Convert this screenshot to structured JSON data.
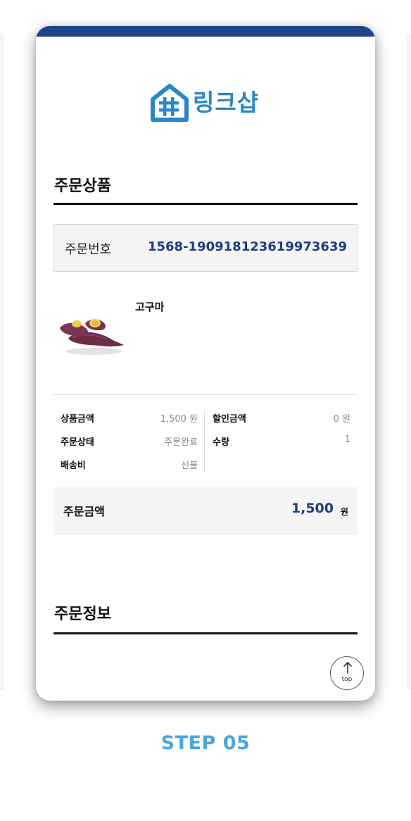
{
  "brand": {
    "name": "링크샵"
  },
  "colors": {
    "header_bar": "#1d4587",
    "accent_navy": "#1d3e80",
    "brand_blue": "#2c86c6",
    "step_blue": "#4aa4e0"
  },
  "order_section": {
    "title": "주문상품",
    "order_number_label": "주문번호",
    "order_number": "1568-190918123619973639",
    "product": {
      "name": "고구마",
      "image": "sweet-potato-image"
    },
    "details": {
      "product_amount_label": "상품금액",
      "product_amount": "1,500 원",
      "discount_label": "할인금액",
      "discount": "0 원",
      "status_label": "주문상태",
      "status": "주문완료",
      "quantity_label": "수량",
      "quantity": "1",
      "shipping_label": "배송비",
      "shipping": "선불"
    },
    "total_label": "주문금액",
    "total_amount": "1,500",
    "total_unit": "원"
  },
  "info_section": {
    "title": "주문정보"
  },
  "top_button": {
    "label": "top",
    "icon": "arrow-up-icon"
  },
  "step_label": "STEP 05"
}
